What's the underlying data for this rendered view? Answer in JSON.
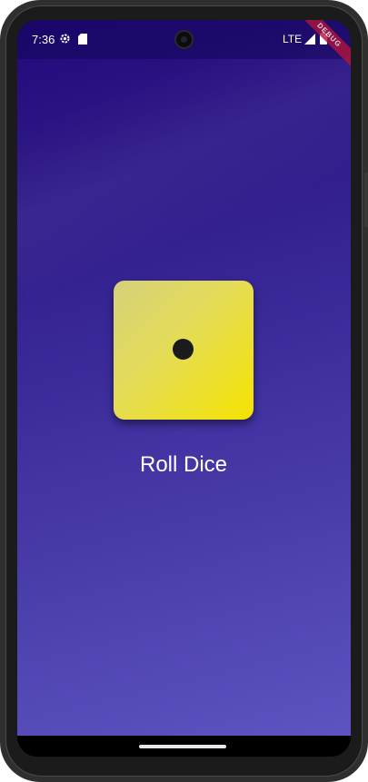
{
  "status_bar": {
    "time": "7:36",
    "network": "LTE",
    "icons": [
      "gear-icon",
      "sd-card-icon",
      "signal-icon",
      "battery-icon"
    ]
  },
  "debug_banner": {
    "label": "DEBUG",
    "color": "#b0163a"
  },
  "die": {
    "face_value": 1,
    "gradient_colors": [
      "#d6d17a",
      "#f5e300"
    ],
    "pip_color": "#1b1b1b"
  },
  "roll_button": {
    "label": "Roll Dice"
  },
  "background": {
    "gradient_colors": [
      "#22097c",
      "#5d54c1"
    ]
  }
}
